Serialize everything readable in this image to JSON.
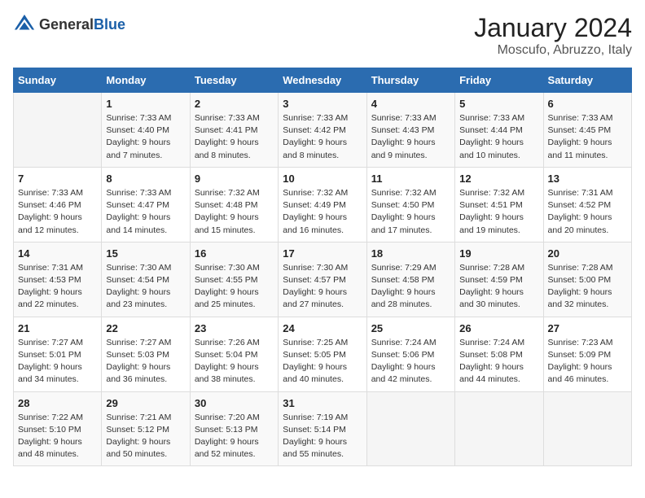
{
  "header": {
    "logo_general": "General",
    "logo_blue": "Blue",
    "title": "January 2024",
    "subtitle": "Moscufo, Abruzzo, Italy"
  },
  "days_of_week": [
    "Sunday",
    "Monday",
    "Tuesday",
    "Wednesday",
    "Thursday",
    "Friday",
    "Saturday"
  ],
  "weeks": [
    [
      {
        "day": "",
        "sunrise": "",
        "sunset": "",
        "daylight": ""
      },
      {
        "day": "1",
        "sunrise": "Sunrise: 7:33 AM",
        "sunset": "Sunset: 4:40 PM",
        "daylight": "Daylight: 9 hours and 7 minutes."
      },
      {
        "day": "2",
        "sunrise": "Sunrise: 7:33 AM",
        "sunset": "Sunset: 4:41 PM",
        "daylight": "Daylight: 9 hours and 8 minutes."
      },
      {
        "day": "3",
        "sunrise": "Sunrise: 7:33 AM",
        "sunset": "Sunset: 4:42 PM",
        "daylight": "Daylight: 9 hours and 8 minutes."
      },
      {
        "day": "4",
        "sunrise": "Sunrise: 7:33 AM",
        "sunset": "Sunset: 4:43 PM",
        "daylight": "Daylight: 9 hours and 9 minutes."
      },
      {
        "day": "5",
        "sunrise": "Sunrise: 7:33 AM",
        "sunset": "Sunset: 4:44 PM",
        "daylight": "Daylight: 9 hours and 10 minutes."
      },
      {
        "day": "6",
        "sunrise": "Sunrise: 7:33 AM",
        "sunset": "Sunset: 4:45 PM",
        "daylight": "Daylight: 9 hours and 11 minutes."
      }
    ],
    [
      {
        "day": "7",
        "sunrise": "Sunrise: 7:33 AM",
        "sunset": "Sunset: 4:46 PM",
        "daylight": "Daylight: 9 hours and 12 minutes."
      },
      {
        "day": "8",
        "sunrise": "Sunrise: 7:33 AM",
        "sunset": "Sunset: 4:47 PM",
        "daylight": "Daylight: 9 hours and 14 minutes."
      },
      {
        "day": "9",
        "sunrise": "Sunrise: 7:32 AM",
        "sunset": "Sunset: 4:48 PM",
        "daylight": "Daylight: 9 hours and 15 minutes."
      },
      {
        "day": "10",
        "sunrise": "Sunrise: 7:32 AM",
        "sunset": "Sunset: 4:49 PM",
        "daylight": "Daylight: 9 hours and 16 minutes."
      },
      {
        "day": "11",
        "sunrise": "Sunrise: 7:32 AM",
        "sunset": "Sunset: 4:50 PM",
        "daylight": "Daylight: 9 hours and 17 minutes."
      },
      {
        "day": "12",
        "sunrise": "Sunrise: 7:32 AM",
        "sunset": "Sunset: 4:51 PM",
        "daylight": "Daylight: 9 hours and 19 minutes."
      },
      {
        "day": "13",
        "sunrise": "Sunrise: 7:31 AM",
        "sunset": "Sunset: 4:52 PM",
        "daylight": "Daylight: 9 hours and 20 minutes."
      }
    ],
    [
      {
        "day": "14",
        "sunrise": "Sunrise: 7:31 AM",
        "sunset": "Sunset: 4:53 PM",
        "daylight": "Daylight: 9 hours and 22 minutes."
      },
      {
        "day": "15",
        "sunrise": "Sunrise: 7:30 AM",
        "sunset": "Sunset: 4:54 PM",
        "daylight": "Daylight: 9 hours and 23 minutes."
      },
      {
        "day": "16",
        "sunrise": "Sunrise: 7:30 AM",
        "sunset": "Sunset: 4:55 PM",
        "daylight": "Daylight: 9 hours and 25 minutes."
      },
      {
        "day": "17",
        "sunrise": "Sunrise: 7:30 AM",
        "sunset": "Sunset: 4:57 PM",
        "daylight": "Daylight: 9 hours and 27 minutes."
      },
      {
        "day": "18",
        "sunrise": "Sunrise: 7:29 AM",
        "sunset": "Sunset: 4:58 PM",
        "daylight": "Daylight: 9 hours and 28 minutes."
      },
      {
        "day": "19",
        "sunrise": "Sunrise: 7:28 AM",
        "sunset": "Sunset: 4:59 PM",
        "daylight": "Daylight: 9 hours and 30 minutes."
      },
      {
        "day": "20",
        "sunrise": "Sunrise: 7:28 AM",
        "sunset": "Sunset: 5:00 PM",
        "daylight": "Daylight: 9 hours and 32 minutes."
      }
    ],
    [
      {
        "day": "21",
        "sunrise": "Sunrise: 7:27 AM",
        "sunset": "Sunset: 5:01 PM",
        "daylight": "Daylight: 9 hours and 34 minutes."
      },
      {
        "day": "22",
        "sunrise": "Sunrise: 7:27 AM",
        "sunset": "Sunset: 5:03 PM",
        "daylight": "Daylight: 9 hours and 36 minutes."
      },
      {
        "day": "23",
        "sunrise": "Sunrise: 7:26 AM",
        "sunset": "Sunset: 5:04 PM",
        "daylight": "Daylight: 9 hours and 38 minutes."
      },
      {
        "day": "24",
        "sunrise": "Sunrise: 7:25 AM",
        "sunset": "Sunset: 5:05 PM",
        "daylight": "Daylight: 9 hours and 40 minutes."
      },
      {
        "day": "25",
        "sunrise": "Sunrise: 7:24 AM",
        "sunset": "Sunset: 5:06 PM",
        "daylight": "Daylight: 9 hours and 42 minutes."
      },
      {
        "day": "26",
        "sunrise": "Sunrise: 7:24 AM",
        "sunset": "Sunset: 5:08 PM",
        "daylight": "Daylight: 9 hours and 44 minutes."
      },
      {
        "day": "27",
        "sunrise": "Sunrise: 7:23 AM",
        "sunset": "Sunset: 5:09 PM",
        "daylight": "Daylight: 9 hours and 46 minutes."
      }
    ],
    [
      {
        "day": "28",
        "sunrise": "Sunrise: 7:22 AM",
        "sunset": "Sunset: 5:10 PM",
        "daylight": "Daylight: 9 hours and 48 minutes."
      },
      {
        "day": "29",
        "sunrise": "Sunrise: 7:21 AM",
        "sunset": "Sunset: 5:12 PM",
        "daylight": "Daylight: 9 hours and 50 minutes."
      },
      {
        "day": "30",
        "sunrise": "Sunrise: 7:20 AM",
        "sunset": "Sunset: 5:13 PM",
        "daylight": "Daylight: 9 hours and 52 minutes."
      },
      {
        "day": "31",
        "sunrise": "Sunrise: 7:19 AM",
        "sunset": "Sunset: 5:14 PM",
        "daylight": "Daylight: 9 hours and 55 minutes."
      },
      {
        "day": "",
        "sunrise": "",
        "sunset": "",
        "daylight": ""
      },
      {
        "day": "",
        "sunrise": "",
        "sunset": "",
        "daylight": ""
      },
      {
        "day": "",
        "sunrise": "",
        "sunset": "",
        "daylight": ""
      }
    ]
  ]
}
